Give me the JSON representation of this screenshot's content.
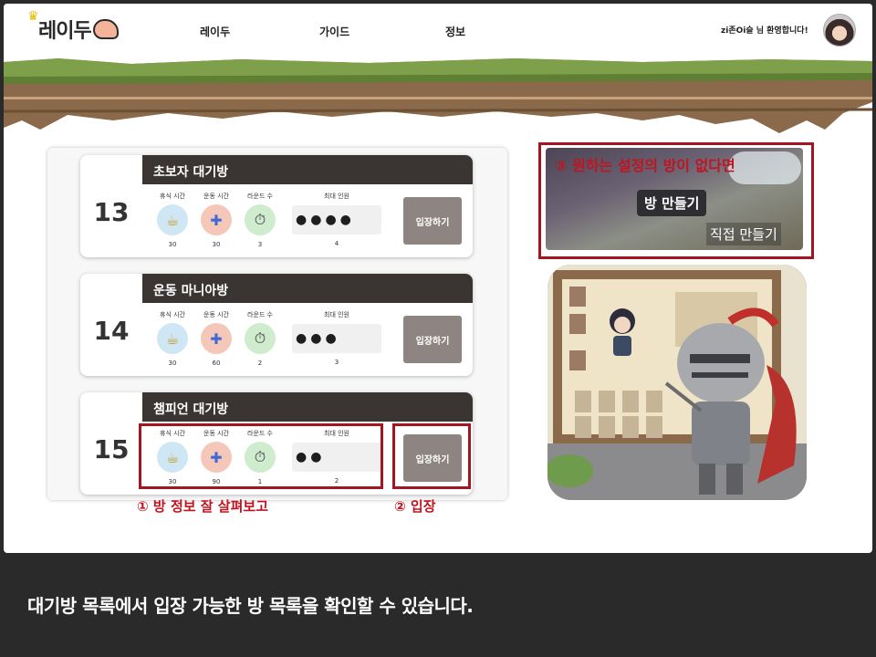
{
  "header": {
    "logo_text": "레이두",
    "nav": [
      "레이두",
      "가이드",
      "정보"
    ],
    "welcome": "zi존Oi슬 님 환영합니다!"
  },
  "rooms": [
    {
      "number": "13",
      "title": "초보자 대기방",
      "labels": {
        "rest": "휴식 시간",
        "exercise": "운동 시간",
        "round": "라운드 수",
        "max": "최대 인원"
      },
      "rest": "30",
      "exercise": "30",
      "round": "3",
      "max": "4",
      "persons": 4,
      "enter_label": "입장하기"
    },
    {
      "number": "14",
      "title": "운동 마니아방",
      "labels": {
        "rest": "휴식 시간",
        "exercise": "운동 시간",
        "round": "라운드 수",
        "max": "최대 인원"
      },
      "rest": "30",
      "exercise": "60",
      "round": "2",
      "max": "3",
      "persons": 3,
      "enter_label": "입장하기"
    },
    {
      "number": "15",
      "title": "챔피언 대기방",
      "labels": {
        "rest": "휴식 시간",
        "exercise": "운동 시간",
        "round": "라운드 수",
        "max": "최대 인원"
      },
      "rest": "30",
      "exercise": "90",
      "round": "1",
      "max": "2",
      "persons": 2,
      "enter_label": "입장하기"
    }
  ],
  "create_room": {
    "button_label": "방 만들기",
    "sub_label": "직접 만들기"
  },
  "annotations": {
    "note1": "① 방 정보 잘 살펴보고",
    "note2": "② 입장",
    "note3": "③ 원하는 설정의 방이 없다면"
  },
  "caption": "대기방 목록에서 입장 가능한 방 목록을 확인할 수 있습니다.",
  "colors": {
    "highlight": "#a31621",
    "title_bar": "#3a3433",
    "enter_button": "#8e8582"
  }
}
